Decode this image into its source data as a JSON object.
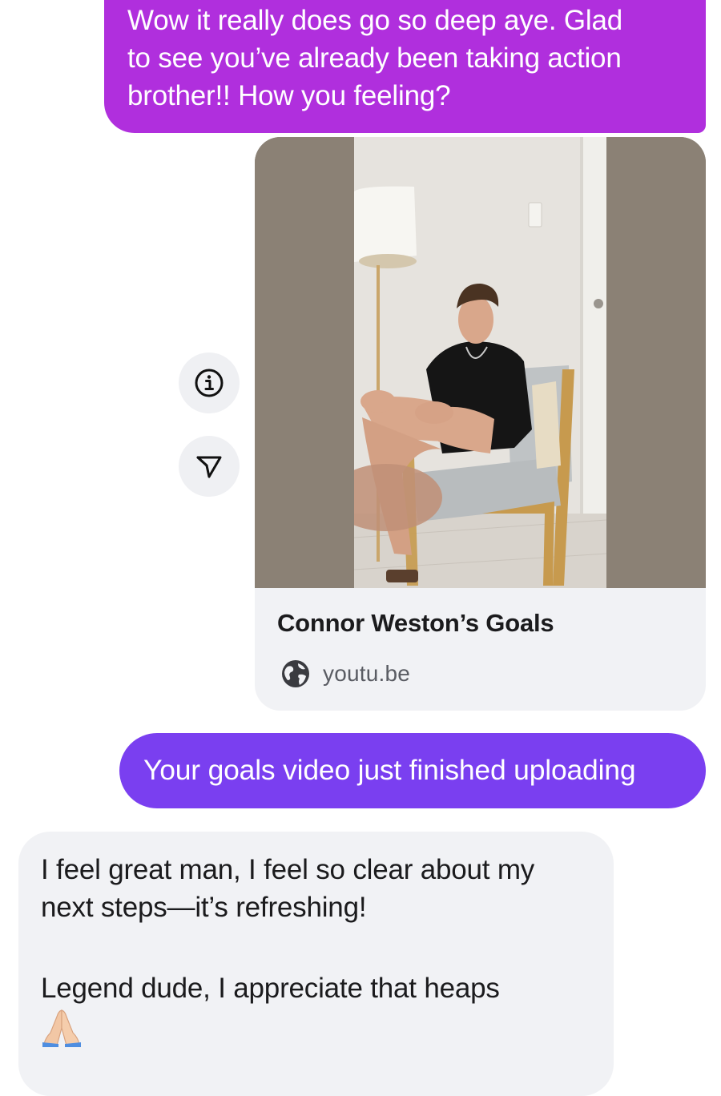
{
  "messages": {
    "outgoing_1": {
      "lines": [
        "Wow it really does go so deep aye. Glad",
        "to see you’ve already been taking action",
        "brother!! How you feeling?"
      ]
    },
    "link_card": {
      "title": "Connor Weston’s Goals",
      "domain": "youtu.be",
      "icon": "globe-icon"
    },
    "outgoing_2": {
      "text": "Your goals video just finished uploading"
    },
    "incoming_1": {
      "line_1": "I feel great man, I feel so clear about my",
      "line_2": "next steps—it’s refreshing!",
      "line_3": "Legend dude, I appreciate that heaps",
      "emoji": "🙏🏼"
    }
  },
  "actions": {
    "info_icon": "info-icon",
    "share_icon": "send-icon"
  },
  "colors": {
    "outgoing_bubble_1": "#b02fdd",
    "outgoing_bubble_2": "#7a3ff0",
    "incoming_bubble": "#f1f2f5",
    "link_card_bg": "#f1f2f5",
    "action_button_bg": "#eff0f3"
  }
}
